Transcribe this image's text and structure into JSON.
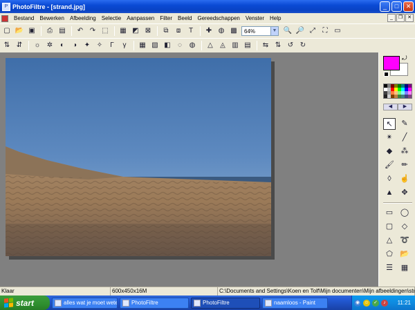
{
  "window": {
    "title": "PhotoFiltre - [strand.jpg]",
    "app_icon": "photofiltre-app-icon",
    "controls": [
      "minimize-icon",
      "maximize-icon",
      "close-icon"
    ]
  },
  "menubar": {
    "items": [
      "Bestand",
      "Bewerken",
      "Afbeelding",
      "Selectie",
      "Aanpassen",
      "Filter",
      "Beeld",
      "Gereedschappen",
      "Venster",
      "Help"
    ],
    "mdi_controls": [
      "minimize-icon",
      "restore-icon",
      "close-icon"
    ]
  },
  "toolbar": {
    "zoom_value": "64%"
  },
  "palette": {
    "foreground_color": "#ff00ff",
    "background_color": "#ffffff",
    "swatches": [
      "#000000",
      "#808080",
      "#800000",
      "#808000",
      "#008000",
      "#008080",
      "#000080",
      "#800080",
      "#ffffff",
      "#c0c0c0",
      "#ff0000",
      "#ffff00",
      "#00ff00",
      "#00ffff",
      "#0000ff",
      "#ff00ff",
      "#404040",
      "#a0a0a0",
      "#ff8040",
      "#ffc080",
      "#80ff80",
      "#80ffff",
      "#8080ff",
      "#ff80ff",
      "#202020",
      "#d0d0d0",
      "#804000",
      "#c08040",
      "#408040",
      "#408080",
      "#404080",
      "#804080"
    ]
  },
  "statusbar": {
    "state": "Klaar",
    "dimensions": "600x450x16M",
    "path": "C:\\Documents and Settings\\Koen en Tolf\\Mijn documenten\\Mijn afbeeldingen\\strand.jpg"
  },
  "taskbar": {
    "start_label": "start",
    "tasks": [
      {
        "label": "alles wat je moet weten",
        "active": false
      },
      {
        "label": "PhotoFiltre",
        "active": false
      },
      {
        "label": "PhotoFiltre",
        "active": true
      },
      {
        "label": "naamloos - Paint",
        "active": false
      }
    ],
    "clock": "11:21"
  }
}
